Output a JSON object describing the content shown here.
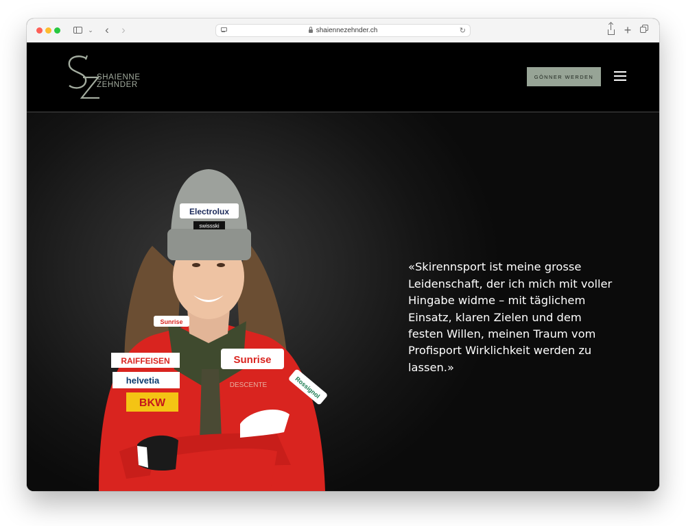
{
  "browser": {
    "url": "shaiennezehnder.ch"
  },
  "header": {
    "logo_monogram": "SZ",
    "logo_line1": "SHAIENNE",
    "logo_line2": "ZEHNDER",
    "cta_label": "GÖNNER WERDEN"
  },
  "hero": {
    "quote": "«Skirennsport ist meine grosse Leidenschaft, der ich mich mit voller Hingabe widme – mit täglichem Einsatz, klaren Zielen und dem festen Willen, meinen Traum vom Profisport Wirklichkeit werden zu lassen.»",
    "photo_texts": {
      "beanie_brand": "Electrolux",
      "beanie_sub": "swissski",
      "collar": "Sunrise",
      "patch1": "RAIFFEISEN",
      "patch2": "helvetia",
      "patch3": "BKW",
      "chest": "Sunrise",
      "logo_descente": "DESCENTE",
      "sleeve": "Rossignol"
    }
  },
  "colors": {
    "accent": "#97a496",
    "logo": "#a3ac9f",
    "jacket": "#d9241f"
  },
  "icons": [
    "sidebar-icon",
    "chevron-down-icon",
    "back-icon",
    "forward-icon",
    "lock-icon",
    "reload-icon",
    "share-icon",
    "new-tab-icon",
    "tab-overview-icon",
    "menu-icon"
  ]
}
